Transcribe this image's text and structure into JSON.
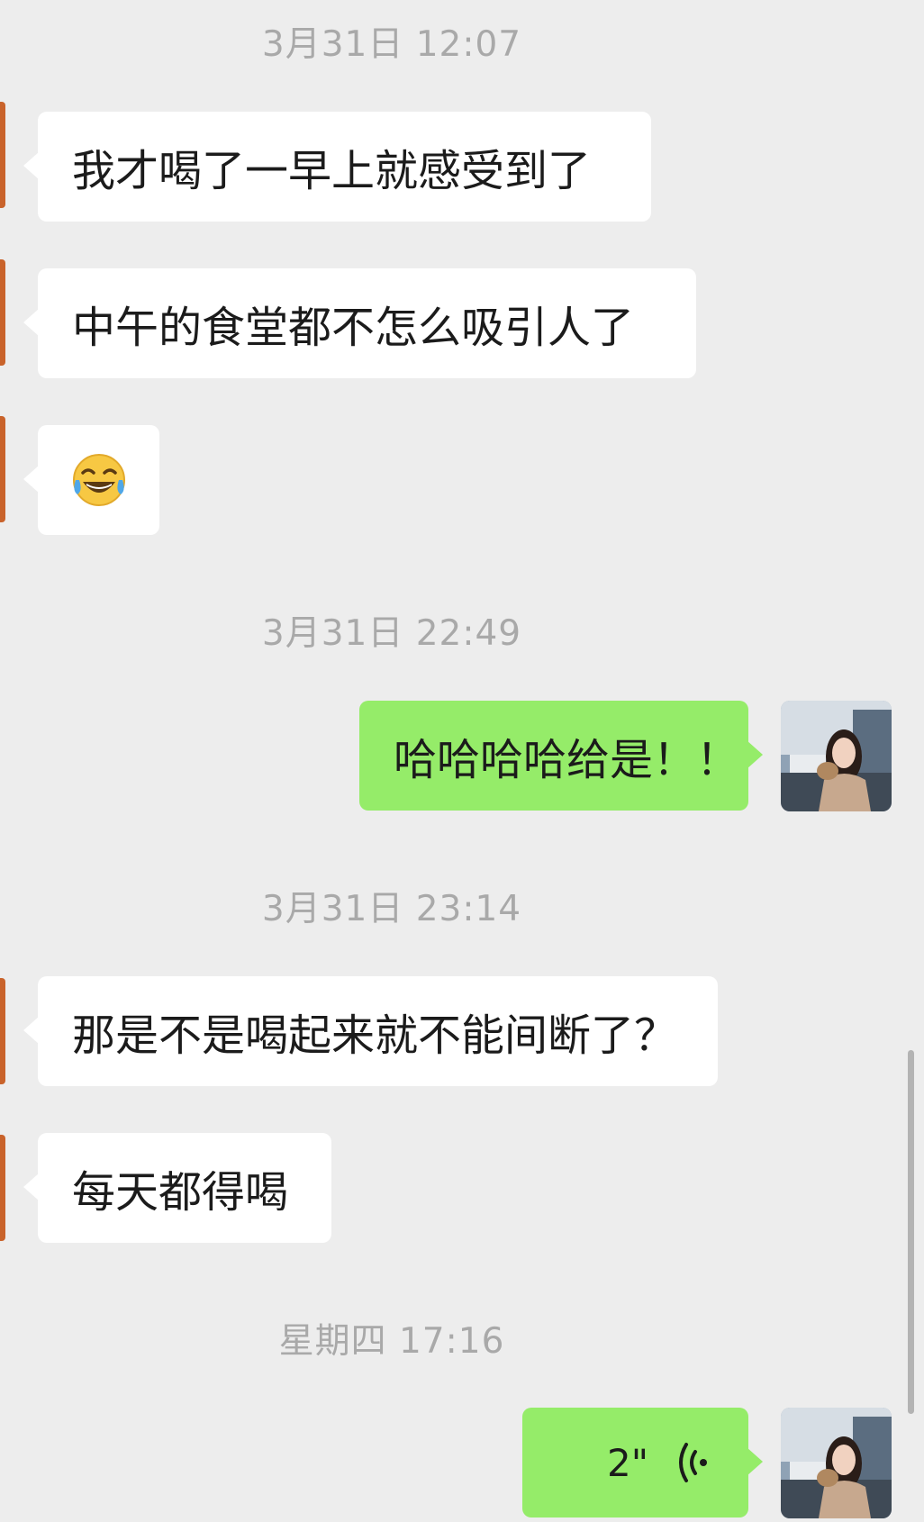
{
  "messages": [
    {
      "type": "timestamp",
      "text": "3月31日 12:07"
    },
    {
      "type": "incoming",
      "text": "我才喝了一早上就感受到了"
    },
    {
      "type": "incoming",
      "text": "中午的食堂都不怎么吸引人了"
    },
    {
      "type": "incoming",
      "emoji": "tears-of-joy"
    },
    {
      "type": "timestamp",
      "text": "3月31日 22:49"
    },
    {
      "type": "outgoing",
      "text": "哈哈哈哈给是！！"
    },
    {
      "type": "timestamp",
      "text": "3月31日 23:14"
    },
    {
      "type": "incoming",
      "text": "那是不是喝起来就不能间断了？"
    },
    {
      "type": "incoming",
      "text": "每天都得喝"
    },
    {
      "type": "timestamp",
      "text": "星期四 17:16"
    },
    {
      "type": "outgoing_voice",
      "duration": "2\""
    }
  ],
  "colors": {
    "background": "#ededed",
    "incoming_bubble": "#ffffff",
    "outgoing_bubble": "#95ec69",
    "timestamp": "#a9a9a9",
    "edge_accent": "#c9632b"
  },
  "icons": {
    "voice": "voice-wave-icon",
    "emoji": "tears-of-joy-emoji"
  }
}
